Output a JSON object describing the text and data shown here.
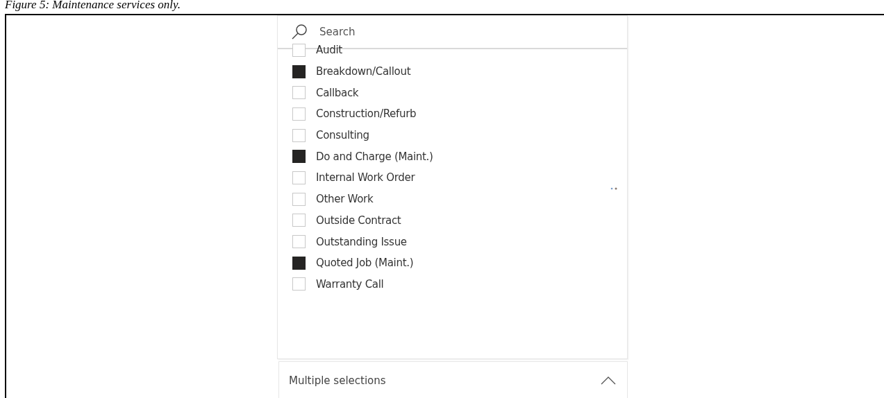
{
  "caption": "Figure 5: Maintenance services only.",
  "search": {
    "placeholder": "Search"
  },
  "items": [
    {
      "label": "Audit",
      "checked": false
    },
    {
      "label": "Breakdown/Callout",
      "checked": true
    },
    {
      "label": "Callback",
      "checked": false
    },
    {
      "label": "Construction/Refurb",
      "checked": false
    },
    {
      "label": "Consulting",
      "checked": false
    },
    {
      "label": "Do and Charge (Maint.)",
      "checked": true
    },
    {
      "label": "Internal Work Order",
      "checked": false
    },
    {
      "label": "Other Work",
      "checked": false
    },
    {
      "label": "Outside Contract",
      "checked": false
    },
    {
      "label": "Outstanding Issue",
      "checked": false
    },
    {
      "label": "Quoted Job (Maint.)",
      "checked": true
    },
    {
      "label": "Warranty Call",
      "checked": false
    }
  ],
  "dropdown": {
    "value": "Multiple selections",
    "expanded": true
  }
}
